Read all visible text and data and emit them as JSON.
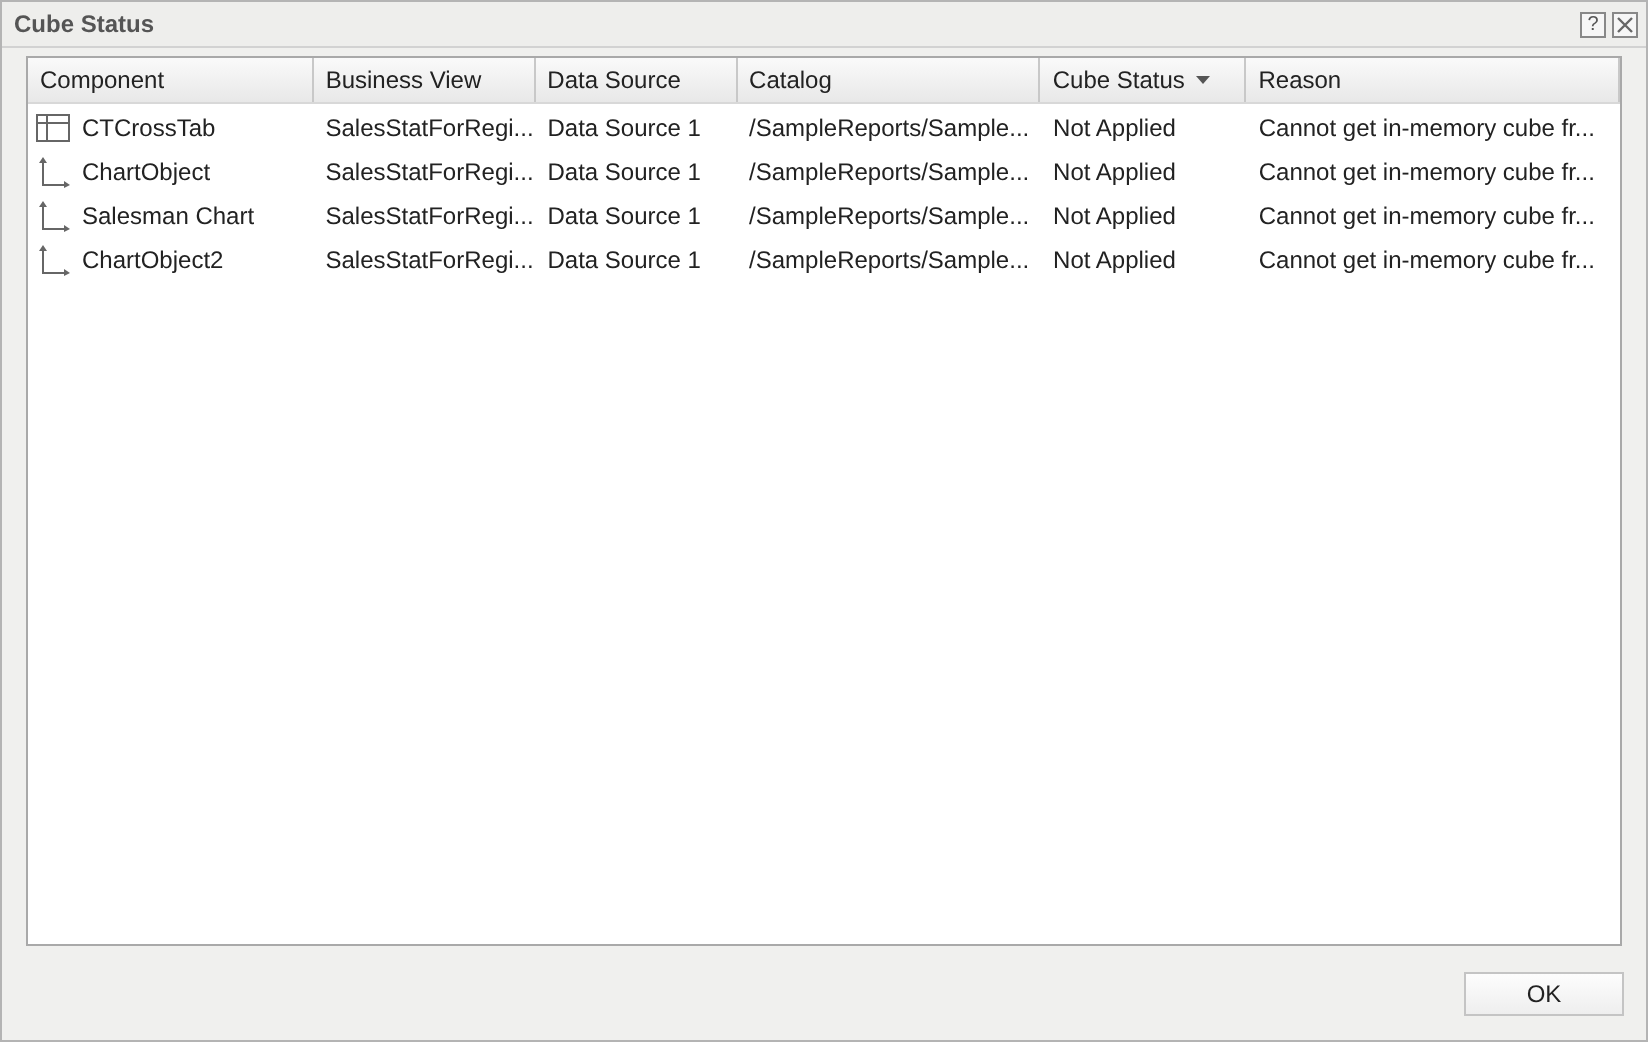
{
  "window": {
    "title": "Cube Status",
    "help_label": "?"
  },
  "table": {
    "columns": [
      {
        "label": "Component",
        "sorted": false
      },
      {
        "label": "Business View",
        "sorted": false
      },
      {
        "label": "Data Source",
        "sorted": false
      },
      {
        "label": "Catalog",
        "sorted": false
      },
      {
        "label": "Cube Status",
        "sorted": true
      },
      {
        "label": "Reason",
        "sorted": false
      }
    ],
    "rows": [
      {
        "kind": "crosstab",
        "cells": [
          "CTCrossTab",
          "SalesStatForRegi...",
          "Data Source 1",
          "/SampleReports/Sample...",
          "Not Applied",
          "Cannot get in-memory cube fr..."
        ]
      },
      {
        "kind": "chart",
        "cells": [
          "ChartObject",
          "SalesStatForRegi...",
          "Data Source 1",
          "/SampleReports/Sample...",
          "Not Applied",
          "Cannot get in-memory cube fr..."
        ]
      },
      {
        "kind": "chart",
        "cells": [
          "Salesman Chart",
          "SalesStatForRegi...",
          "Data Source 1",
          "/SampleReports/Sample...",
          "Not Applied",
          "Cannot get in-memory cube fr..."
        ]
      },
      {
        "kind": "chart",
        "cells": [
          "ChartObject2",
          "SalesStatForRegi...",
          "Data Source 1",
          "/SampleReports/Sample...",
          "Not Applied",
          "Cannot get in-memory cube fr..."
        ]
      }
    ]
  },
  "buttons": [
    "OK"
  ]
}
